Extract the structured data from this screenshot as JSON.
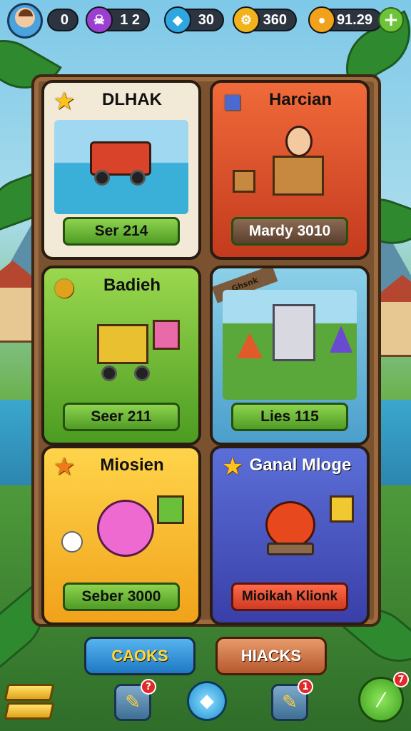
{
  "topbar": {
    "level": "0",
    "potions": "1 2",
    "gems": "30",
    "gears": "360",
    "coins": "91.29",
    "colors": {
      "potion": "#9b3fd0",
      "gem": "#2ea6e0",
      "gear": "#f2b21a",
      "coin": "#f2a21a",
      "plus": "#6cc43a"
    },
    "icons": {
      "avatar": "player-avatar-icon",
      "potion": "potion-icon",
      "gem": "gem-icon",
      "gear": "gear-icon",
      "coin": "coin-icon",
      "plus": "plus-icon"
    }
  },
  "cards": [
    {
      "title": "DLHAK",
      "button": "Ser 214",
      "icon": "star-icon"
    },
    {
      "title": "Harcian",
      "button": "Mardy 3010",
      "icon": "cube-icon"
    },
    {
      "title": "Badieh",
      "button": "Seer 211",
      "icon": "coin-badge-icon"
    },
    {
      "title": "",
      "button": "Lies 115",
      "banner": "Ghsnk",
      "icon": "banner-icon"
    },
    {
      "title": "Miosien",
      "button": "Seber 3000",
      "icon": "star-icon"
    },
    {
      "title": "Ganal Mloge",
      "button": "Mioikah Klionk",
      "icon": "star-icon"
    }
  ],
  "bottom": {
    "left_tab": "CAOKS",
    "right_tab": "HIACKS",
    "left_badge": "?",
    "right_badge": "1",
    "green_badge": "7"
  }
}
